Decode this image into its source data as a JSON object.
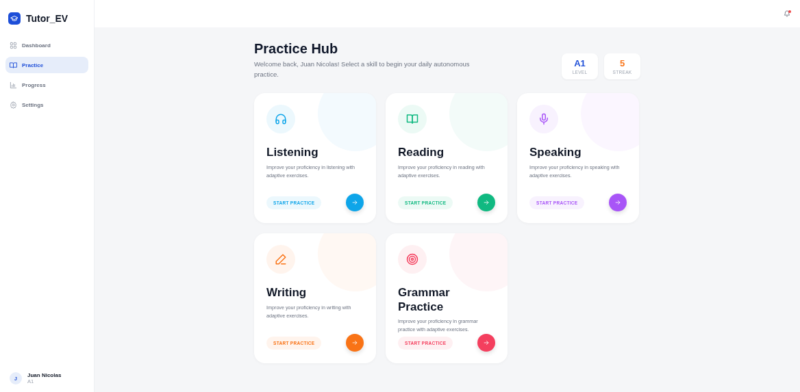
{
  "brand": {
    "name": "Tutor_EV"
  },
  "nav": [
    {
      "label": "Dashboard",
      "selected": false
    },
    {
      "label": "Practice",
      "selected": true
    },
    {
      "label": "Progress",
      "selected": false
    },
    {
      "label": "Settings",
      "selected": false
    }
  ],
  "user": {
    "initial": "J",
    "name": "Juan Nicolas",
    "level": "A1"
  },
  "topbar": {
    "notification": true
  },
  "header": {
    "title": "Practice Hub",
    "subtitle": "Welcome back, Juan Nicolas! Select a skill to begin your daily autonomous practice."
  },
  "stats": [
    {
      "value": "A1",
      "label": "LEVEL",
      "color": "#1d4ed8"
    },
    {
      "value": "5",
      "label": "STREAK",
      "color": "#f97316"
    }
  ],
  "skills": [
    {
      "title": "Listening",
      "description": "Improve your proficiency in listening with adaptive exercises.",
      "action": "START PRACTICE",
      "color": "#0ea5e9"
    },
    {
      "title": "Reading",
      "description": "Improve your proficiency in reading with adaptive exercises.",
      "action": "START PRACTICE",
      "color": "#10b981"
    },
    {
      "title": "Speaking",
      "description": "Improve your proficiency in speaking with adaptive exercises.",
      "action": "START PRACTICE",
      "color": "#a855f7"
    },
    {
      "title": "Writing",
      "description": "Improve your proficiency in writing with adaptive exercises.",
      "action": "START PRACTICE",
      "color": "#f97316"
    },
    {
      "title": "Grammar Practice",
      "description": "Improve your proficiency in grammar practice with adaptive exercises.",
      "action": "START PRACTICE",
      "color": "#f43f5e"
    }
  ]
}
